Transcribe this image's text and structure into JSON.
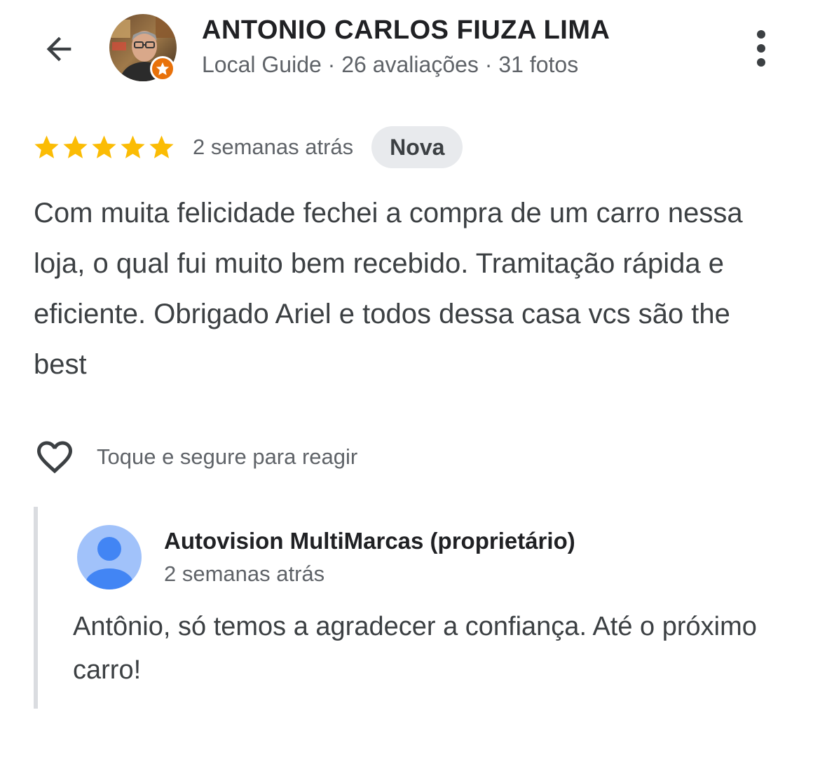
{
  "header": {
    "back_icon": "arrow-back-icon",
    "reviewer_name": "ANTONIO CARLOS FIUZA LIMA",
    "reviewer_meta": "Local Guide · 26 avaliações · 31 fotos",
    "badge_icon": "local-guide-star-icon",
    "more_icon": "more-vert-icon"
  },
  "review": {
    "rating": 5,
    "rating_max": 5,
    "star_color": "#fbbc04",
    "date": "2 semanas atrás",
    "badge": "Nova",
    "text": "Com muita felicidade fechei a compra de um carro nessa loja, o qual fui muito bem recebido. Tramitação rápida e eficiente. Obrigado Ariel e todos dessa casa vcs são the best"
  },
  "reaction": {
    "icon": "heart-outline-icon",
    "label": "Toque e segure para reagir"
  },
  "owner_reply": {
    "avatar_icon": "person-avatar-icon",
    "name": "Autovision MultiMarcas (proprietário)",
    "date": "2 semanas atrás",
    "text": "Antônio, só temos a agradecer a confiança. Até o próximo carro!"
  },
  "colors": {
    "accent_badge": "#e8710a",
    "owner_avatar_bg": "#a1c2fa",
    "owner_avatar_fg": "#4285f4"
  }
}
